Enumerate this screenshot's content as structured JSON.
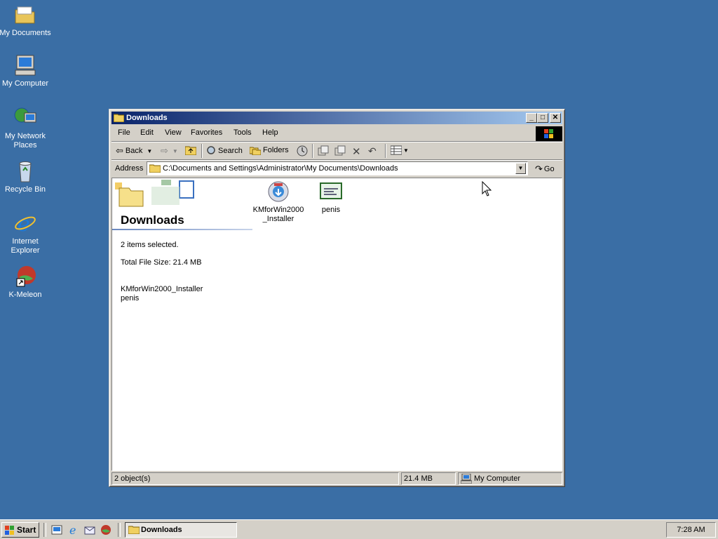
{
  "desktop": {
    "icons": [
      {
        "label": "My Documents"
      },
      {
        "label": "My Computer"
      },
      {
        "label": "My Network Places"
      },
      {
        "label": "Recycle Bin"
      },
      {
        "label": "Internet Explorer"
      },
      {
        "label": "K-Meleon"
      }
    ]
  },
  "window": {
    "title": "Downloads",
    "menu": [
      "File",
      "Edit",
      "View",
      "Favorites",
      "Tools",
      "Help"
    ],
    "toolbar": {
      "back": "Back",
      "search": "Search",
      "folders": "Folders"
    },
    "address": {
      "label": "Address",
      "value": "C:\\Documents and Settings\\Administrator\\My Documents\\Downloads",
      "go": "Go"
    },
    "webview": {
      "title": "Downloads",
      "selection": "2 items selected.",
      "total_size": "Total File Size: 21.4 MB",
      "selected_files": [
        "KMforWin2000_Installer",
        "penis"
      ]
    },
    "files": [
      {
        "name_line1": "KMforWin2000",
        "name_line2": "_Installer",
        "icon": "installer-icon"
      },
      {
        "name_line1": "penis",
        "name_line2": "",
        "icon": "certificate-icon"
      }
    ],
    "status": {
      "objects": "2 object(s)",
      "size": "21.4 MB",
      "zone": "My Computer"
    }
  },
  "taskbar": {
    "start": "Start",
    "task": "Downloads",
    "clock": "7:28 AM"
  },
  "colors": {
    "desktop": "#3a6ea5",
    "title_active_start": "#0a246a",
    "title_active_end": "#a6caf0",
    "face": "#d4d0c8"
  }
}
